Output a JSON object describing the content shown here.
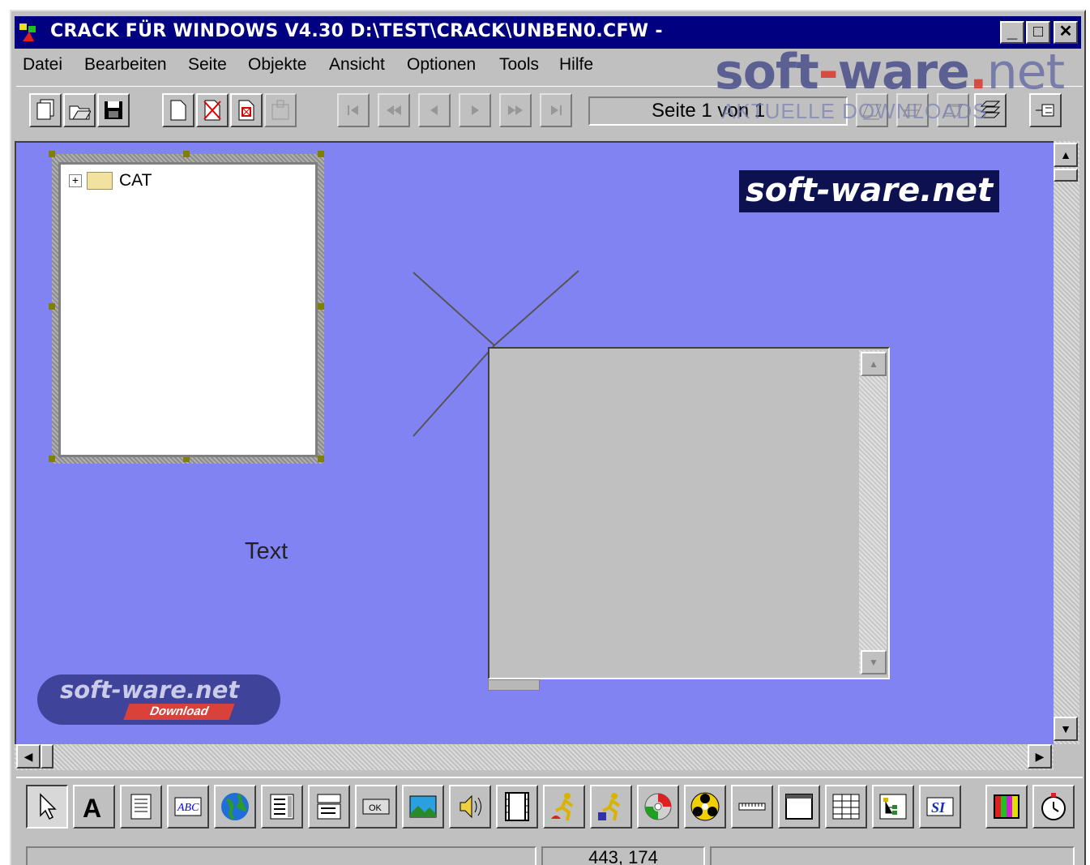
{
  "window": {
    "title": "CRACK FÜR WINDOWS V4.30 D:\\TEST\\CRACK\\UNBEN0.CFW -",
    "minimize": "_",
    "maximize": "□",
    "close": "✕"
  },
  "menu": {
    "items": [
      {
        "label": "Datei"
      },
      {
        "label": "Bearbeiten"
      },
      {
        "label": "Seite"
      },
      {
        "label": "Objekte"
      },
      {
        "label": "Ansicht"
      },
      {
        "label": "Optionen"
      },
      {
        "label": "Tools"
      },
      {
        "label": "Hilfe"
      }
    ]
  },
  "watermark": {
    "brand": "soft",
    "dash": "-",
    "brand2": "ware",
    "dot": ".",
    "tld": "net",
    "subtitle": "AKTUELLE DOWNLOADS"
  },
  "toolbar": {
    "page_indicator": "Seite 1 von 1"
  },
  "canvas": {
    "background_color": "#8183f3",
    "tree_root_label": "CAT",
    "text_object": "Text",
    "logo_right": "soft-ware.net",
    "logo_badge": "soft-ware.net",
    "logo_badge_sub": "Download"
  },
  "statusbar": {
    "panel1": "",
    "coordinates": "443, 174",
    "panel3": ""
  }
}
